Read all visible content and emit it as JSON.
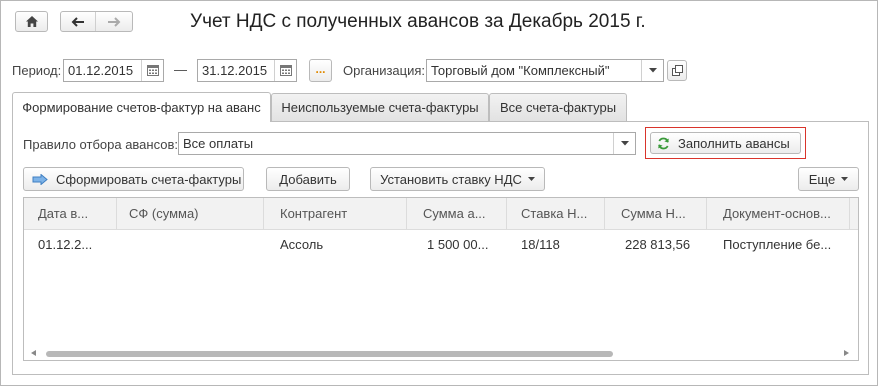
{
  "window": {
    "title": "Учет НДС с полученных авансов за Декабрь 2015 г."
  },
  "nav": {
    "home_icon": "home-icon",
    "back_icon": "arrow-left-icon",
    "forward_icon": "arrow-right-icon"
  },
  "filters": {
    "period_label": "Период:",
    "period_from": "01.12.2015",
    "dash": "—",
    "period_to": "31.12.2015",
    "more_label": "...",
    "org_label": "Организация:",
    "org_value": "Торговый дом \"Комплексный\""
  },
  "tabs": [
    {
      "label": "Формирование счетов-фактур на аванс",
      "active": true
    },
    {
      "label": "Неиспользуемые счета-фактуры",
      "active": false
    },
    {
      "label": "Все счета-фактуры",
      "active": false
    }
  ],
  "rule": {
    "label": "Правило отбора авансов:",
    "value": "Все оплаты",
    "fill_button": "Заполнить авансы"
  },
  "toolbar": {
    "form_invoices": "Сформировать счета-фактуры",
    "add": "Добавить",
    "set_vat": "Установить ставку НДС",
    "more": "Еще"
  },
  "table": {
    "columns": [
      "Дата в...",
      "СФ (сумма)",
      "Контрагент",
      "Сумма а...",
      "Ставка Н...",
      "Сумма Н...",
      "Документ-основ..."
    ],
    "rows": [
      [
        "01.12.2...",
        "",
        "Ассоль",
        "1 500 00...",
        "18/118",
        "228 813,56",
        "Поступление бе..."
      ]
    ]
  },
  "colors": {
    "accent_border": "#d9342b",
    "refresh_icon": "#3a9a3a",
    "form_icon": "#4a90d9"
  }
}
